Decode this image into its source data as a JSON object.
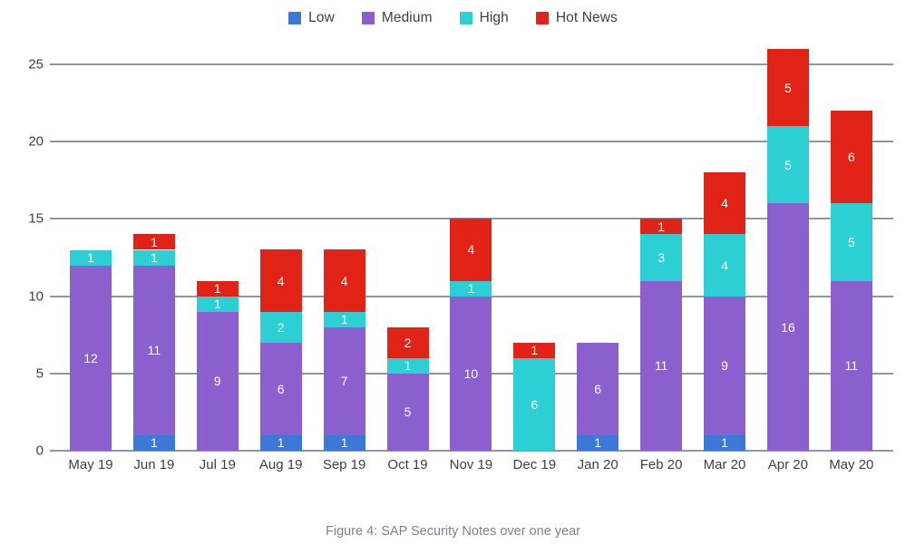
{
  "caption": "Figure 4: SAP Security Notes over one year",
  "legend": {
    "position": "top-center",
    "items": [
      {
        "label": "Low",
        "color": "#3b78d8"
      },
      {
        "label": "Medium",
        "color": "#8b5fce"
      },
      {
        "label": "High",
        "color": "#2ccfd3"
      },
      {
        "label": "Hot News",
        "color": "#e02316"
      }
    ]
  },
  "axis": {
    "y_ticks": [
      "0",
      "5",
      "10",
      "15",
      "20",
      "25"
    ],
    "x_labels": [
      "May 19",
      "Jun 19",
      "Jul 19",
      "Aug 19",
      "Sep 19",
      "Oct 19",
      "Nov 19",
      "Dec 19",
      "Jan 20",
      "Feb 20",
      "Mar 20",
      "Apr 20",
      "May 20"
    ]
  },
  "chart_data": {
    "type": "bar",
    "subtype": "stacked",
    "title": "Figure 4: SAP Security Notes over one year",
    "xlabel": "",
    "ylabel": "",
    "ylim": [
      0,
      27
    ],
    "yticks": [
      0,
      5,
      10,
      15,
      20,
      25
    ],
    "grid": true,
    "legend_position": "top-center",
    "categories": [
      "May 19",
      "Jun 19",
      "Jul 19",
      "Aug 19",
      "Sep 19",
      "Oct 19",
      "Nov 19",
      "Dec 19",
      "Jan 20",
      "Feb 20",
      "Mar 20",
      "Apr 20",
      "May 20"
    ],
    "series": [
      {
        "name": "Low",
        "color": "#3b78d8",
        "values": [
          0,
          1,
          0,
          1,
          1,
          0,
          0,
          0,
          1,
          0,
          1,
          0,
          0
        ]
      },
      {
        "name": "Medium",
        "color": "#8b5fce",
        "values": [
          12,
          11,
          9,
          6,
          7,
          5,
          10,
          0,
          6,
          11,
          9,
          16,
          11
        ]
      },
      {
        "name": "High",
        "color": "#2ccfd3",
        "values": [
          1,
          1,
          1,
          2,
          1,
          1,
          1,
          6,
          0,
          3,
          4,
          5,
          5
        ]
      },
      {
        "name": "Hot News",
        "color": "#e02316",
        "values": [
          0,
          1,
          1,
          4,
          4,
          2,
          4,
          1,
          0,
          1,
          4,
          5,
          6
        ]
      }
    ],
    "totals": [
      13,
      14,
      11,
      13,
      13,
      8,
      15,
      7,
      7,
      15,
      18,
      26,
      22
    ]
  }
}
